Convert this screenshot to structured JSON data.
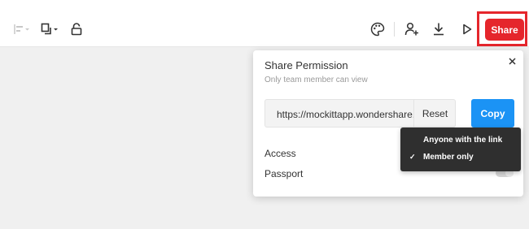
{
  "toolbar": {
    "share_label": "Share",
    "icons": [
      "align-icon",
      "copy-icon",
      "lock-icon",
      "palette-icon",
      "add-user-icon",
      "download-icon",
      "play-icon"
    ]
  },
  "share_panel": {
    "title": "Share Permission",
    "subtitle": "Only team member can view",
    "link_url": "https://mockittapp.wondershare.",
    "reset_label": "Reset",
    "copy_label": "Copy",
    "access_label": "Access",
    "passport_label": "Passport",
    "passport_enabled": false
  },
  "access_dropdown": {
    "options": [
      "Anyone with the link",
      "Member only"
    ],
    "selected": "Member only"
  },
  "colors": {
    "share_red": "#e5262c",
    "copy_blue": "#1b93f5",
    "dropdown_bg": "#2f2f2f"
  }
}
